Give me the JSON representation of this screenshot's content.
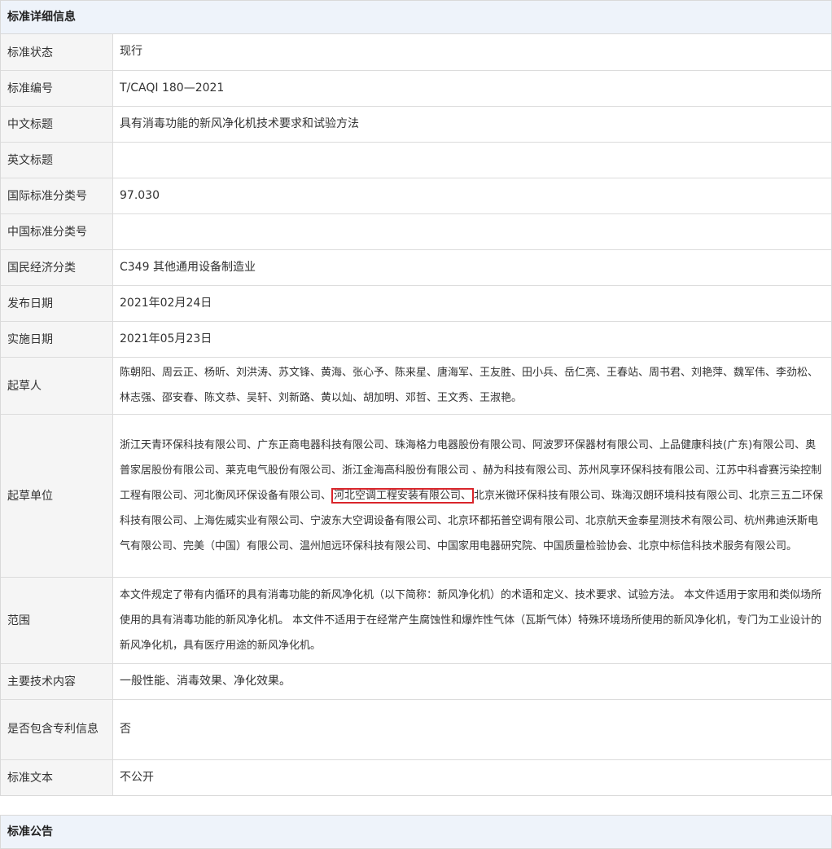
{
  "detail_panel": {
    "title": "标准详细信息",
    "rows": [
      {
        "label": "标准状态",
        "value": "现行"
      },
      {
        "label": "标准编号",
        "value": "T/CAQI 180—2021"
      },
      {
        "label": "中文标题",
        "value": "具有消毒功能的新风净化机技术要求和试验方法"
      },
      {
        "label": "英文标题",
        "value": ""
      },
      {
        "label": "国际标准分类号",
        "value": "97.030"
      },
      {
        "label": "中国标准分类号",
        "value": ""
      },
      {
        "label": "国民经济分类",
        "value": "C349 其他通用设备制造业"
      },
      {
        "label": "发布日期",
        "value": "2021年02月24日"
      },
      {
        "label": "实施日期",
        "value": "2021年05月23日"
      },
      {
        "label": "起草人",
        "value": "陈朝阳、周云正、杨昕、刘洪涛、苏文锋、黄海、张心予、陈来星、唐海军、王友胜、田小兵、岳仁亮、王春站、周书君、刘艳萍、魏军伟、李劲松、林志强、邵安春、陈文恭、吴轩、刘新路、黄以灿、胡加明、邓哲、王文秀、王淑艳。"
      },
      {
        "label": "起草单位",
        "value_before": "浙江天青环保科技有限公司、广东正商电器科技有限公司、珠海格力电器股份有限公司、阿波罗环保器材有限公司、上品健康科技(广东)有限公司、奥普家居股份有限公司、莱克电气股份有限公司、浙江金海高科股份有限公司 、赫为科技有限公司、苏州风享环保科技有限公司、江苏中科睿赛污染控制工程有限公司、河北衡风环保设备有限公司、",
        "value_highlight": "河北空调工程安装有限公司、",
        "value_after": "北京米微环保科技有限公司、珠海汉朗环境科技有限公司、北京三五二环保科技有限公司、上海佐威实业有限公司、宁波东大空调设备有限公司、北京环都拓普空调有限公司、北京航天金泰星测技术有限公司、杭州弗迪沃斯电气有限公司、完美（中国）有限公司、温州旭远环保科技有限公司、中国家用电器研究院、中国质量检验协会、北京中标信科技术服务有限公司。"
      },
      {
        "label": "范围",
        "value": "本文件规定了带有内循环的具有消毒功能的新风净化机（以下简称：新风净化机）的术语和定义、技术要求、试验方法。 本文件适用于家用和类似场所使用的具有消毒功能的新风净化机。 本文件不适用于在经常产生腐蚀性和爆炸性气体（瓦斯气体）特殊环境场所使用的新风净化机，专门为工业设计的新风净化机，具有医疗用途的新风净化机。"
      },
      {
        "label": "主要技术内容",
        "value": "一般性能、消毒效果、净化效果。"
      },
      {
        "label": "是否包含专利信息",
        "value": "否"
      },
      {
        "label": "标准文本",
        "value": "不公开"
      }
    ]
  },
  "announcement_panel": {
    "title": "标准公告"
  },
  "colors": {
    "header_bg": "#eef3fa",
    "label_bg": "#f5f5f5",
    "border": "#dcdcdc",
    "highlight_border": "#d9252b"
  }
}
